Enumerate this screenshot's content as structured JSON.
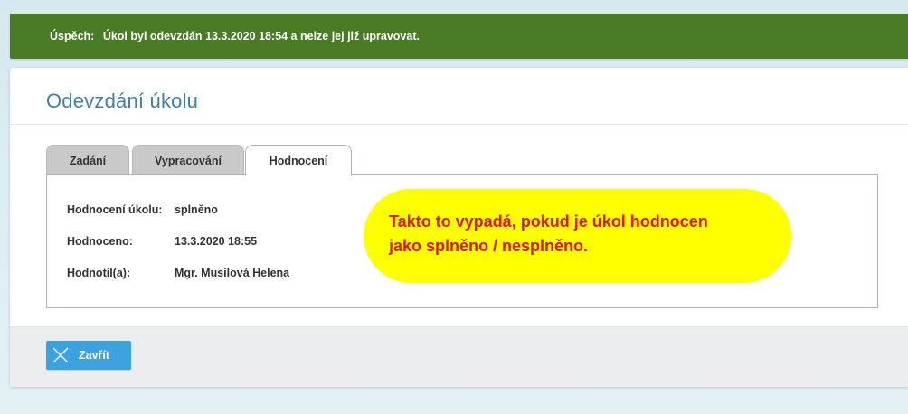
{
  "alert": {
    "prefix": "Úspěch:",
    "message": "Úkol byl odevzdán 13.3.2020 18:54 a nelze jej již upravovat.",
    "color": "#4a7c26"
  },
  "dialog": {
    "title": "Odevzdání úkolu",
    "tabs": [
      {
        "label": "Zadání",
        "active": false
      },
      {
        "label": "Vypracování",
        "active": false
      },
      {
        "label": "Hodnocení",
        "active": true
      }
    ],
    "evaluation": [
      {
        "label": "Hodnocení úkolu:",
        "value": "splněno"
      },
      {
        "label": "Hodnoceno:",
        "value": "13.3.2020 18:55"
      },
      {
        "label": "Hodnotil(a):",
        "value": "Mgr. Musilová Helena"
      }
    ],
    "callout": {
      "line1": "Takto to vypadá, pokud je úkol hodnocen",
      "line2": "jako splněno / nesplněno.",
      "background": "#ffff00",
      "text_color": "#e21414"
    },
    "footer": {
      "close_label": "Zavřít",
      "close_icon": "close-x-icon",
      "button_color": "#3da3e0"
    }
  }
}
